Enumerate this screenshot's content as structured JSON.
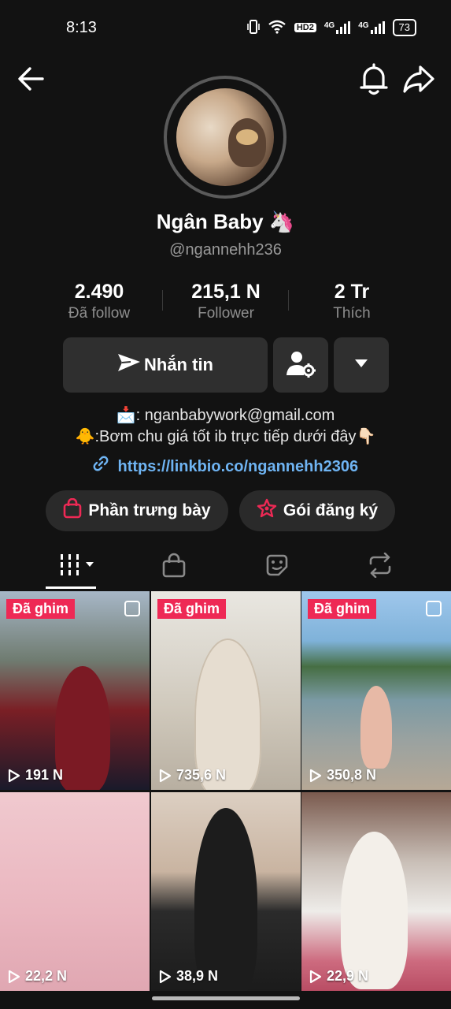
{
  "status_bar": {
    "time": "8:13",
    "hd": "HD2",
    "net1": "4G",
    "net2": "4G",
    "battery": "73"
  },
  "profile": {
    "display_name": "Ngân Baby",
    "name_emoji": "🦄",
    "handle": "@ngannehh236"
  },
  "stats": [
    {
      "value": "2.490",
      "label": "Đã follow"
    },
    {
      "value": "215,1 N",
      "label": "Follower"
    },
    {
      "value": "2 Tr",
      "label": "Thích"
    }
  ],
  "actions": {
    "message_label": "Nhắn tin"
  },
  "bio": {
    "line1": "📩: nganbabywork@gmail.com",
    "line2": "🐥:Bơm chu giá tốt ib trực tiếp dưới đây👇🏻",
    "link": "https://linkbio.co/ngannehh2306"
  },
  "pills": {
    "showcase": "Phần trưng bày",
    "subscription": "Gói đăng ký"
  },
  "videos": [
    {
      "pinned": "Đã ghim",
      "views": "191 N"
    },
    {
      "pinned": "Đã ghim",
      "views": "735,6 N"
    },
    {
      "pinned": "Đã ghim",
      "views": "350,8 N"
    },
    {
      "pinned": "",
      "views": "22,2 N"
    },
    {
      "pinned": "",
      "views": "38,9 N"
    },
    {
      "pinned": "",
      "views": "22,9 N"
    }
  ],
  "colors": {
    "background": "#121212",
    "accent_pin": "#ee2955",
    "link": "#6fb4f3"
  }
}
